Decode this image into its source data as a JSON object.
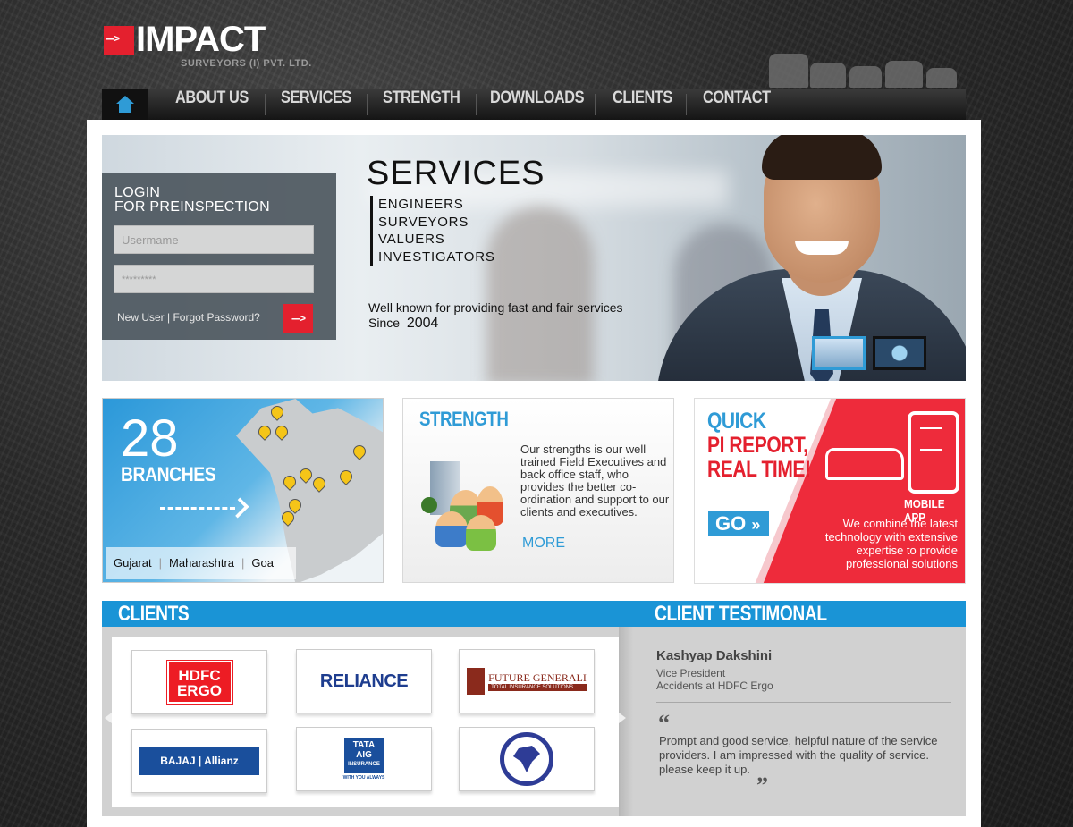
{
  "brand": {
    "name": "IMPACT",
    "subtitle": "SURVEYORS (I) PVT. LTD.",
    "accent_color": "#e4202e",
    "blue_color": "#2f9bd6"
  },
  "nav": {
    "home_icon": "home-icon",
    "items": [
      {
        "label": "ABOUT US"
      },
      {
        "label": "SERVICES"
      },
      {
        "label": "STRENGTH"
      },
      {
        "label": "DOWNLOADS"
      },
      {
        "label": "CLIENTS"
      },
      {
        "label": "CONTACT"
      }
    ]
  },
  "login": {
    "title_line1": "LOGIN",
    "title_line2": "FOR PREINSPECTION",
    "username_placeholder": "Usermame",
    "password_placeholder": "*********",
    "links": "New User | Forgot Password?",
    "submit_icon": "arrow-right-icon"
  },
  "hero": {
    "heading": "SERVICES",
    "services": [
      "ENGINEERS",
      "SURVEYORS",
      "VALUERS",
      "INVESTIGATORS"
    ],
    "tagline_line1": "Well known for providing fast and fair services",
    "tagline_line2_prefix": "Since",
    "tagline_year": "2004"
  },
  "branches": {
    "count": "28",
    "label": "BRANCHES",
    "states": [
      "Gujarat",
      "Maharashtra",
      "Goa"
    ]
  },
  "strength": {
    "title": "STRENGTH",
    "text": "Our strengths is our well trained Field Executives and back office staff, who provides the better co-ordination and support to our clients and executives.",
    "more": "MORE"
  },
  "mobile_app": {
    "title_line1": "QUICK",
    "title_line2": "PI REPORT,",
    "title_line3": "REAL TIME!",
    "go_label": "GO",
    "badge": "MOBILE APP",
    "description": "We combine the latest technology with extensive expertise to provide professional solutions"
  },
  "clients": {
    "title": "CLIENTS",
    "logos": [
      {
        "name": "HDFC ERGO",
        "line1": "HDFC",
        "line2": "ERGO"
      },
      {
        "name": "RELIANCE",
        "text": "RELIANCE"
      },
      {
        "name": "FUTURE GENERALI",
        "text": "FUTURE GENERALI",
        "tag": "TOTAL INSURANCE SOLUTIONS"
      },
      {
        "name": "BAJAJ Allianz",
        "text": "BAJAJ | Allianz"
      },
      {
        "name": "TATA AIG INSURANCE",
        "line1": "TATA",
        "line2": "AIG",
        "line3": "INSURANCE",
        "tag": "WITH YOU ALWAYS"
      },
      {
        "name": "The New India Assurance Co. Ltd."
      }
    ]
  },
  "testimonial": {
    "title": "CLIENT TESTIMONAL",
    "name": "Kashyap Dakshini",
    "role_line1": "Vice President",
    "role_line2": "Accidents at HDFC Ergo",
    "quote": "Prompt and good service, helpful nature of the service providers. I am impressed with the quality of service. please keep it up."
  }
}
